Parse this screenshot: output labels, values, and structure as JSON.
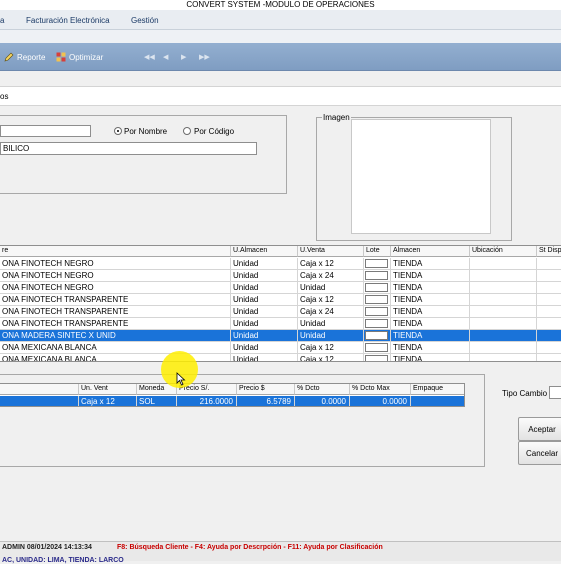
{
  "window": {
    "title": "CONVERT SYSTEM -MODULO DE OPERACIONES"
  },
  "menu": {
    "items": [
      {
        "label": "a"
      },
      {
        "label": "Facturación Electrónica"
      },
      {
        "label": "Gestión"
      }
    ]
  },
  "toolbar": {
    "reporte_label": "Reporte",
    "optimizar_label": "Optimizar"
  },
  "tab": {
    "label": "os"
  },
  "search": {
    "code_value": "",
    "radio_nombre_label": "Por Nombre",
    "radio_codigo_label": "Por Código",
    "selected_mode": "Por Nombre",
    "text_value": "BILICO"
  },
  "image_panel": {
    "label": "Imagen"
  },
  "products_table": {
    "columns": [
      "re",
      "U.Almacen",
      "U.Venta",
      "Lote",
      "Almacen",
      "Ubicación",
      "St Disp"
    ],
    "rows": [
      {
        "nombre": "ONA FINOTECH NEGRO",
        "u_almacen": "Unidad",
        "u_venta": "Caja x 12",
        "almacen": "TIENDA"
      },
      {
        "nombre": "ONA FINOTECH NEGRO",
        "u_almacen": "Unidad",
        "u_venta": "Caja x 24",
        "almacen": "TIENDA"
      },
      {
        "nombre": "ONA FINOTECH NEGRO",
        "u_almacen": "Unidad",
        "u_venta": "Unidad",
        "almacen": "TIENDA"
      },
      {
        "nombre": "ONA FINOTECH TRANSPARENTE",
        "u_almacen": "Unidad",
        "u_venta": "Caja x 12",
        "almacen": "TIENDA"
      },
      {
        "nombre": "ONA FINOTECH TRANSPARENTE",
        "u_almacen": "Unidad",
        "u_venta": "Caja x 24",
        "almacen": "TIENDA"
      },
      {
        "nombre": "ONA FINOTECH TRANSPARENTE",
        "u_almacen": "Unidad",
        "u_venta": "Unidad",
        "almacen": "TIENDA"
      },
      {
        "nombre": "ONA MADERA SINTEC X UNID",
        "u_almacen": "Unidad",
        "u_venta": "Unidad",
        "almacen": "TIENDA"
      },
      {
        "nombre": "ONA MEXICANA BLANCA",
        "u_almacen": "Unidad",
        "u_venta": "Caja x 12",
        "almacen": "TIENDA"
      },
      {
        "nombre": "ONA MEXICANA BLANCA",
        "u_almacen": "Unidad",
        "u_venta": "Caja x 12",
        "almacen": "TIENDA"
      }
    ],
    "selected_index": 6
  },
  "price_table": {
    "columns": [
      "Un. Vent",
      "Moneda",
      "Precio S/.",
      "Precio $",
      "% Dcto",
      "% Dcto Max",
      "Empaque"
    ],
    "rows": [
      {
        "un_vent": "Caja x 12",
        "moneda": "SOL",
        "precio_sol": "216.0000",
        "precio_usd": "6.5789",
        "dcto": "0.0000",
        "dcto_max": "0.0000",
        "empaque": ""
      }
    ]
  },
  "side_panel": {
    "tipo_cambio_label": "Tipo Cambio",
    "tipo_cambio_value": "",
    "aceptar_label": "Aceptar",
    "cancelar_label": "Cancelar"
  },
  "statusbar": {
    "user_datetime": "ADMIN   08/01/2024 14:13:34",
    "help_text": "F8: Búsqueda Cliente - F4: Ayuda por Descrpción - F11: Ayuda por Clasificación",
    "location_text": "AC, UNIDAD: LIMA, TIENDA: LARCO"
  },
  "colors": {
    "toolbar": "#8aa7cb",
    "selection": "#1a73d9",
    "status_help": "#c80000"
  }
}
